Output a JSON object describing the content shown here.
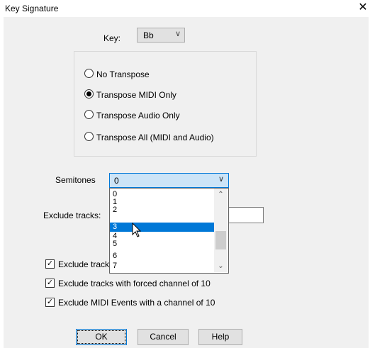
{
  "window": {
    "title": "Key Signature",
    "close_glyph": "✕"
  },
  "key": {
    "label": "Key:",
    "value": "Bb",
    "arrow": "∨"
  },
  "transpose": {
    "options": [
      {
        "label": "No Transpose",
        "checked": false
      },
      {
        "label": "Transpose MIDI Only",
        "checked": true
      },
      {
        "label": "Transpose Audio Only",
        "checked": false
      },
      {
        "label": "Transpose All (MIDI and Audio)",
        "checked": false
      }
    ]
  },
  "semitones": {
    "label": "Semitones",
    "value": "0",
    "arrow": "∨",
    "dropdown_items": [
      "0",
      "1",
      "2",
      "3",
      "4",
      "5",
      "6",
      "7"
    ],
    "selected_index": 3
  },
  "exclude_tracks": {
    "label": "Exclude tracks:",
    "value": ""
  },
  "checkboxes": [
    {
      "label": "Exclude track",
      "checked": true
    },
    {
      "label": "Exclude tracks with forced channel of 10",
      "checked": true
    },
    {
      "label": "Exclude MIDI Events with a channel of 10",
      "checked": true
    }
  ],
  "buttons": {
    "ok": "OK",
    "cancel": "Cancel",
    "help": "Help"
  },
  "icons": {
    "scroll_up": "⌃",
    "scroll_down": "⌄",
    "check": "✓"
  }
}
